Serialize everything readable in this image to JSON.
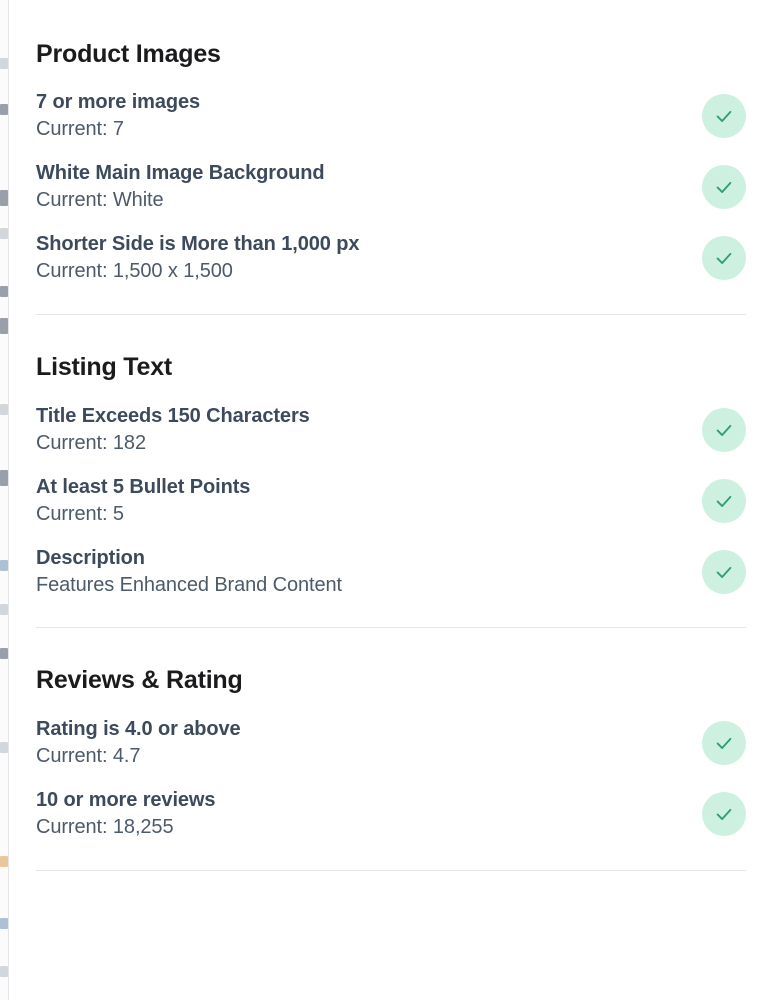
{
  "card": {
    "sections": [
      {
        "id": "product-images",
        "heading": "Product Images",
        "rules": [
          {
            "title": "7 or more images",
            "current": "Current: 7",
            "status": "pass",
            "status_icon": "check-icon"
          },
          {
            "title": "White Main Image Background",
            "current": "Current: White",
            "status": "pass",
            "status_icon": "check-icon"
          },
          {
            "title": "Shorter Side is More than 1,000 px",
            "current": "Current: 1,500 x 1,500",
            "status": "pass",
            "status_icon": "check-icon"
          }
        ]
      },
      {
        "id": "listing-text",
        "heading": "Listing Text",
        "rules": [
          {
            "title": "Title Exceeds 150 Characters",
            "current": "Current: 182",
            "status": "pass",
            "status_icon": "check-icon"
          },
          {
            "title": "At least 5 Bullet Points",
            "current": "Current: 5",
            "status": "pass",
            "status_icon": "check-icon"
          },
          {
            "title": "Description",
            "current": "Features Enhanced Brand Content",
            "status": "pass",
            "status_icon": "check-icon"
          }
        ]
      },
      {
        "id": "reviews-rating",
        "heading": "Reviews & Rating",
        "rules": [
          {
            "title": "Rating is 4.0 or above",
            "current": "Current: 4.7",
            "status": "pass",
            "status_icon": "check-icon"
          },
          {
            "title": "10 or more reviews",
            "current": "Current: 18,255",
            "status": "pass",
            "status_icon": "check-icon"
          }
        ]
      }
    ]
  },
  "colors": {
    "heading": "#1b1b1d",
    "rule_title": "#3d4a5c",
    "rule_current": "#4d5a6a",
    "badge_background": "#cdf0e0",
    "badge_check": "#2f9e74",
    "divider": "#e6e6e8",
    "card_background": "#ffffff"
  }
}
